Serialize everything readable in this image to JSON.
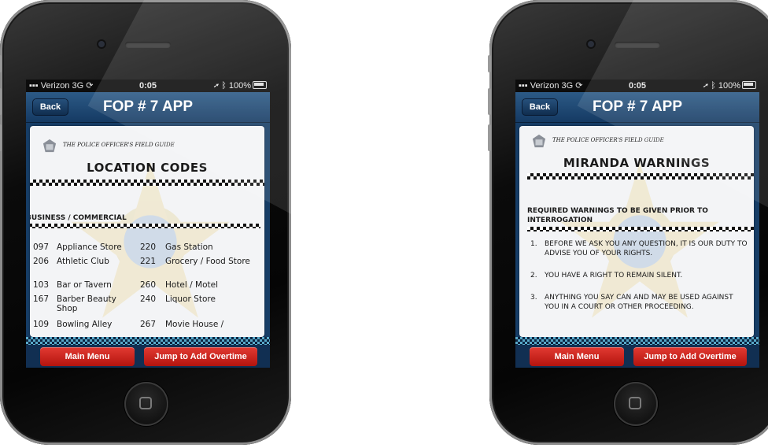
{
  "phones": [
    {
      "status": {
        "carrier": "Verizon 3G",
        "time": "0:05",
        "battery": "100%"
      },
      "nav": {
        "back_label": "Back",
        "title": "FOP # 7 APP"
      },
      "guide_label": "THE POLICE OFFICER'S FIELD GUIDE",
      "title": "LOCATION CODES",
      "section_heading": "BUSINESS / COMMERCIAL",
      "codes": [
        {
          "code_a": "097",
          "name_a": "Appliance Store",
          "code_b": "220",
          "name_b": "Gas Station"
        },
        {
          "code_a": "206",
          "name_a": "Athletic Club",
          "code_b": "221",
          "name_b": "Grocery / Food Store"
        },
        {
          "code_a": "103",
          "name_a": "Bar or Tavern",
          "code_b": "260",
          "name_b": "Hotel / Motel"
        },
        {
          "code_a": "167",
          "name_a": "Barber Beauty Shop",
          "code_b": "240",
          "name_b": "Liquor Store"
        },
        {
          "code_a": "109",
          "name_a": "Bowling Alley",
          "code_b": "267",
          "name_b": "Movie House /"
        }
      ],
      "buttons": {
        "main_menu": "Main Menu",
        "jump": "Jump to Add Overtime"
      }
    },
    {
      "status": {
        "carrier": "Verizon 3G",
        "time": "0:05",
        "battery": "100%"
      },
      "nav": {
        "back_label": "Back",
        "title": "FOP # 7 APP"
      },
      "guide_label": "THE POLICE OFFICER'S FIELD GUIDE",
      "title": "MIRANDA WARNINGS",
      "section_heading": "REQUIRED WARNINGS TO BE GIVEN PRIOR TO INTERROGATION",
      "warnings": [
        {
          "num": "1.",
          "text": "BEFORE WE ASK YOU ANY QUESTION, IT IS OUR DUTY TO ADVISE YOU OF YOUR RIGHTS."
        },
        {
          "num": "2.",
          "text": "YOU HAVE A RIGHT TO REMAIN SILENT."
        },
        {
          "num": "3.",
          "text": "ANYTHING YOU SAY CAN AND MAY BE USED AGAINST YOU IN A COURT OR OTHER PROCEEDING."
        }
      ],
      "buttons": {
        "main_menu": "Main Menu",
        "jump": "Jump to Add Overtime"
      }
    }
  ],
  "colors": {
    "nav_blue": "#1f4b78",
    "button_red": "#d0251d",
    "checker_teal": "#58a9c9"
  },
  "icons": [
    "camera-icon",
    "speaker-icon",
    "home-button-icon",
    "signal-icon",
    "sync-icon",
    "location-arrow-icon",
    "bluetooth-icon",
    "battery-icon",
    "police-badge-icon",
    "star-watermark-icon"
  ]
}
